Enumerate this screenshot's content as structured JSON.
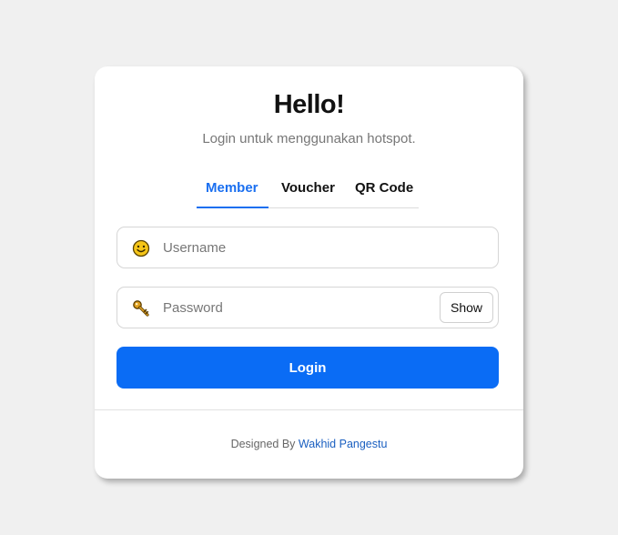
{
  "card": {
    "title": "Hello!",
    "subtitle": "Login untuk menggunakan hotspot."
  },
  "tabs": [
    {
      "label": "Member",
      "active": true
    },
    {
      "label": "Voucher",
      "active": false
    },
    {
      "label": "QR Code",
      "active": false
    }
  ],
  "form": {
    "username": {
      "placeholder": "Username",
      "value": "",
      "icon": "smiley-face-icon"
    },
    "password": {
      "placeholder": "Password",
      "value": "",
      "icon": "key-icon"
    },
    "show_label": "Show",
    "login_label": "Login"
  },
  "footer": {
    "prefix": "Designed By ",
    "author": "Wakhid Pangestu"
  },
  "colors": {
    "accent": "#0a6cf5",
    "background": "#f0f0f0",
    "card": "#ffffff"
  }
}
